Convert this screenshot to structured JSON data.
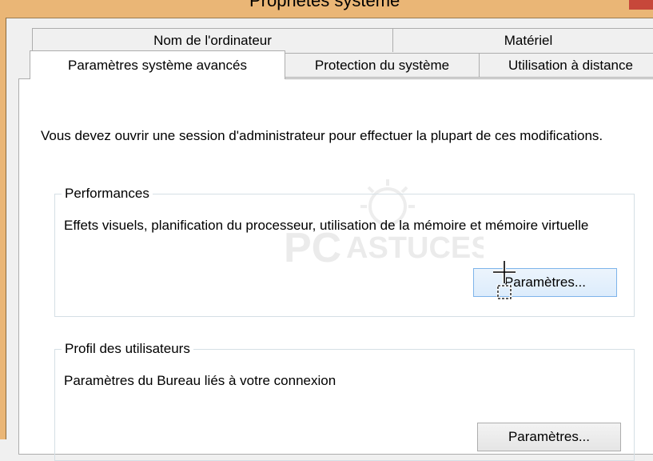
{
  "window": {
    "title": "Propriétés système"
  },
  "tabs": {
    "back": [
      {
        "label": "Nom de l'ordinateur"
      },
      {
        "label": "Matériel"
      }
    ],
    "front": [
      {
        "label": "Paramètres système avancés",
        "selected": true
      },
      {
        "label": "Protection du système",
        "selected": false
      },
      {
        "label": "Utilisation à distance",
        "selected": false
      }
    ]
  },
  "content": {
    "intro": "Vous devez ouvrir une session d'administrateur pour effectuer la plupart de ces modifications.",
    "performances": {
      "title": "Performances",
      "description": "Effets visuels, planification du processeur, utilisation de la mémoire et mémoire virtuelle",
      "button_label": "Paramètres..."
    },
    "profils": {
      "title": "Profil des utilisateurs",
      "description": "Paramètres du Bureau liés à votre connexion",
      "button_label": "Paramètres..."
    }
  },
  "watermark": {
    "text": "PC ASTUCES"
  },
  "colors": {
    "title_bar": "#eab676",
    "close_button": "#c7473a",
    "panel_background": "#ffffff",
    "dialog_background": "#f0f0f0",
    "button_hover_border": "#7eb4ea"
  }
}
